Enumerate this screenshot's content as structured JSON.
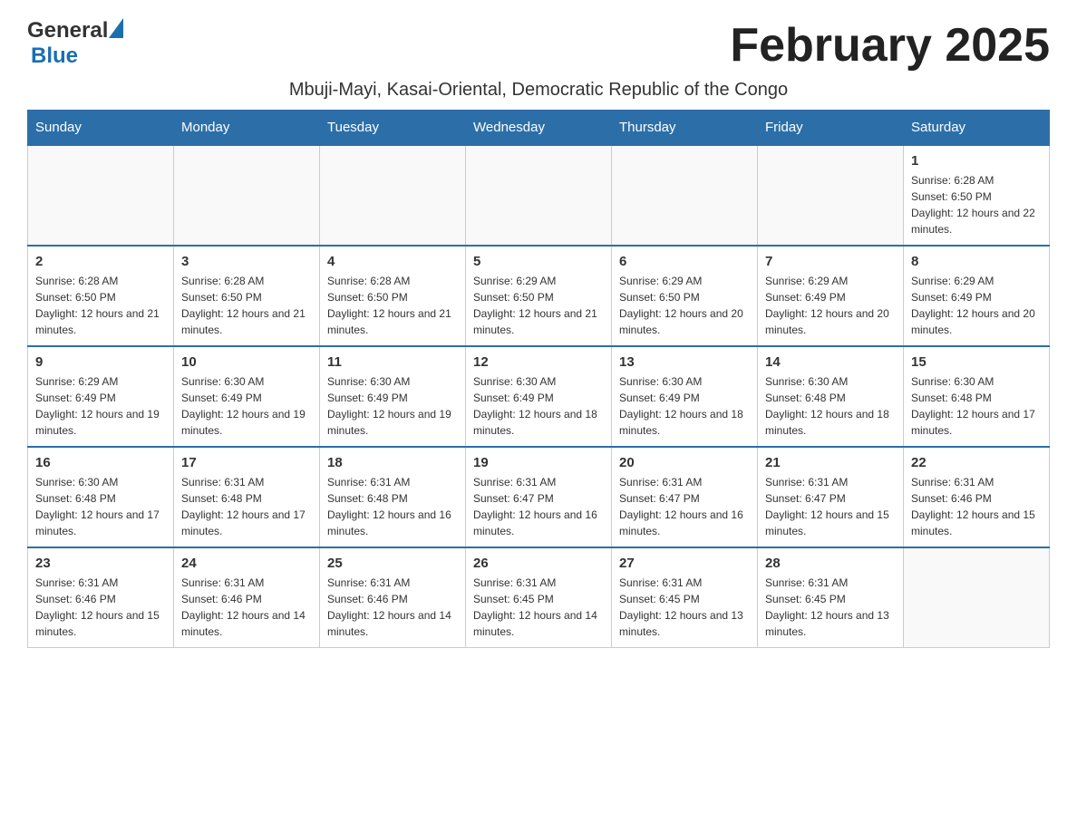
{
  "header": {
    "logo_general": "General",
    "logo_blue": "Blue",
    "month_title": "February 2025",
    "subtitle": "Mbuji-Mayi, Kasai-Oriental, Democratic Republic of the Congo"
  },
  "days_of_week": [
    "Sunday",
    "Monday",
    "Tuesday",
    "Wednesday",
    "Thursday",
    "Friday",
    "Saturday"
  ],
  "weeks": [
    {
      "days": [
        {
          "num": "",
          "info": ""
        },
        {
          "num": "",
          "info": ""
        },
        {
          "num": "",
          "info": ""
        },
        {
          "num": "",
          "info": ""
        },
        {
          "num": "",
          "info": ""
        },
        {
          "num": "",
          "info": ""
        },
        {
          "num": "1",
          "info": "Sunrise: 6:28 AM\nSunset: 6:50 PM\nDaylight: 12 hours and 22 minutes."
        }
      ]
    },
    {
      "days": [
        {
          "num": "2",
          "info": "Sunrise: 6:28 AM\nSunset: 6:50 PM\nDaylight: 12 hours and 21 minutes."
        },
        {
          "num": "3",
          "info": "Sunrise: 6:28 AM\nSunset: 6:50 PM\nDaylight: 12 hours and 21 minutes."
        },
        {
          "num": "4",
          "info": "Sunrise: 6:28 AM\nSunset: 6:50 PM\nDaylight: 12 hours and 21 minutes."
        },
        {
          "num": "5",
          "info": "Sunrise: 6:29 AM\nSunset: 6:50 PM\nDaylight: 12 hours and 21 minutes."
        },
        {
          "num": "6",
          "info": "Sunrise: 6:29 AM\nSunset: 6:50 PM\nDaylight: 12 hours and 20 minutes."
        },
        {
          "num": "7",
          "info": "Sunrise: 6:29 AM\nSunset: 6:49 PM\nDaylight: 12 hours and 20 minutes."
        },
        {
          "num": "8",
          "info": "Sunrise: 6:29 AM\nSunset: 6:49 PM\nDaylight: 12 hours and 20 minutes."
        }
      ]
    },
    {
      "days": [
        {
          "num": "9",
          "info": "Sunrise: 6:29 AM\nSunset: 6:49 PM\nDaylight: 12 hours and 19 minutes."
        },
        {
          "num": "10",
          "info": "Sunrise: 6:30 AM\nSunset: 6:49 PM\nDaylight: 12 hours and 19 minutes."
        },
        {
          "num": "11",
          "info": "Sunrise: 6:30 AM\nSunset: 6:49 PM\nDaylight: 12 hours and 19 minutes."
        },
        {
          "num": "12",
          "info": "Sunrise: 6:30 AM\nSunset: 6:49 PM\nDaylight: 12 hours and 18 minutes."
        },
        {
          "num": "13",
          "info": "Sunrise: 6:30 AM\nSunset: 6:49 PM\nDaylight: 12 hours and 18 minutes."
        },
        {
          "num": "14",
          "info": "Sunrise: 6:30 AM\nSunset: 6:48 PM\nDaylight: 12 hours and 18 minutes."
        },
        {
          "num": "15",
          "info": "Sunrise: 6:30 AM\nSunset: 6:48 PM\nDaylight: 12 hours and 17 minutes."
        }
      ]
    },
    {
      "days": [
        {
          "num": "16",
          "info": "Sunrise: 6:30 AM\nSunset: 6:48 PM\nDaylight: 12 hours and 17 minutes."
        },
        {
          "num": "17",
          "info": "Sunrise: 6:31 AM\nSunset: 6:48 PM\nDaylight: 12 hours and 17 minutes."
        },
        {
          "num": "18",
          "info": "Sunrise: 6:31 AM\nSunset: 6:48 PM\nDaylight: 12 hours and 16 minutes."
        },
        {
          "num": "19",
          "info": "Sunrise: 6:31 AM\nSunset: 6:47 PM\nDaylight: 12 hours and 16 minutes."
        },
        {
          "num": "20",
          "info": "Sunrise: 6:31 AM\nSunset: 6:47 PM\nDaylight: 12 hours and 16 minutes."
        },
        {
          "num": "21",
          "info": "Sunrise: 6:31 AM\nSunset: 6:47 PM\nDaylight: 12 hours and 15 minutes."
        },
        {
          "num": "22",
          "info": "Sunrise: 6:31 AM\nSunset: 6:46 PM\nDaylight: 12 hours and 15 minutes."
        }
      ]
    },
    {
      "days": [
        {
          "num": "23",
          "info": "Sunrise: 6:31 AM\nSunset: 6:46 PM\nDaylight: 12 hours and 15 minutes."
        },
        {
          "num": "24",
          "info": "Sunrise: 6:31 AM\nSunset: 6:46 PM\nDaylight: 12 hours and 14 minutes."
        },
        {
          "num": "25",
          "info": "Sunrise: 6:31 AM\nSunset: 6:46 PM\nDaylight: 12 hours and 14 minutes."
        },
        {
          "num": "26",
          "info": "Sunrise: 6:31 AM\nSunset: 6:45 PM\nDaylight: 12 hours and 14 minutes."
        },
        {
          "num": "27",
          "info": "Sunrise: 6:31 AM\nSunset: 6:45 PM\nDaylight: 12 hours and 13 minutes."
        },
        {
          "num": "28",
          "info": "Sunrise: 6:31 AM\nSunset: 6:45 PM\nDaylight: 12 hours and 13 minutes."
        },
        {
          "num": "",
          "info": ""
        }
      ]
    }
  ]
}
